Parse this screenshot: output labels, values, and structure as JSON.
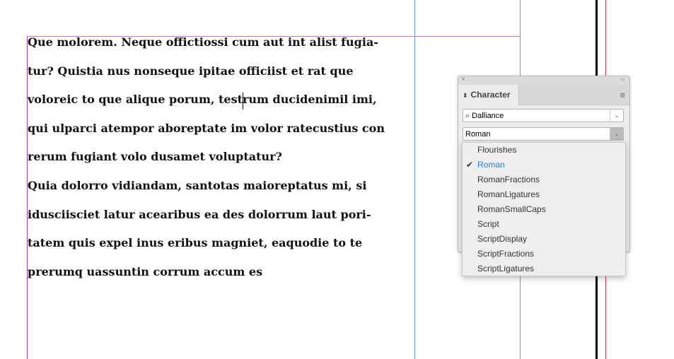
{
  "text_lines": [
    "Que molorem. Neque offictiossi cum aut int alist fugia-",
    "tur? Quistia nus nonseque ipitae officiist et rat que",
    "voloreic to que alique porum, testrum ducidenimil imi,",
    "qui ulparci atempor aboreptate im volor ratecustius con",
    "rerum fugiant volo dusamet voluptatur?",
    "Quia dolorro vidiandam, santotas maioreptatus mi, si",
    "idusciisciet latur acearibus ea des dolorrum laut pori-",
    "tatem quis expel inus eribus magniet, eaquodie to te",
    "prerumq uassuntin corrum accum es"
  ],
  "panel": {
    "close": "×",
    "collapse": "‹‹",
    "tab_label": "Character",
    "tab_icon": "⬍",
    "menu_icon": "≡",
    "font_family": "Dalliance",
    "font_style": "Roman",
    "search_icon": "⌕"
  },
  "style_options": [
    {
      "label": "Flourishes"
    },
    {
      "label": "Roman",
      "selected": true
    },
    {
      "label": "RomanFractions"
    },
    {
      "label": "RomanLigatures"
    },
    {
      "label": "RomanSmallCaps"
    },
    {
      "label": "Script"
    },
    {
      "label": "ScriptDisplay"
    },
    {
      "label": "ScriptFractions"
    },
    {
      "label": "ScriptLigatures"
    }
  ],
  "checkmark": "✔",
  "colors": {
    "accent": "#2a7de1",
    "frame": "#b23ee0",
    "margin": "#5b8cf0",
    "bleed": "#e0364a"
  }
}
